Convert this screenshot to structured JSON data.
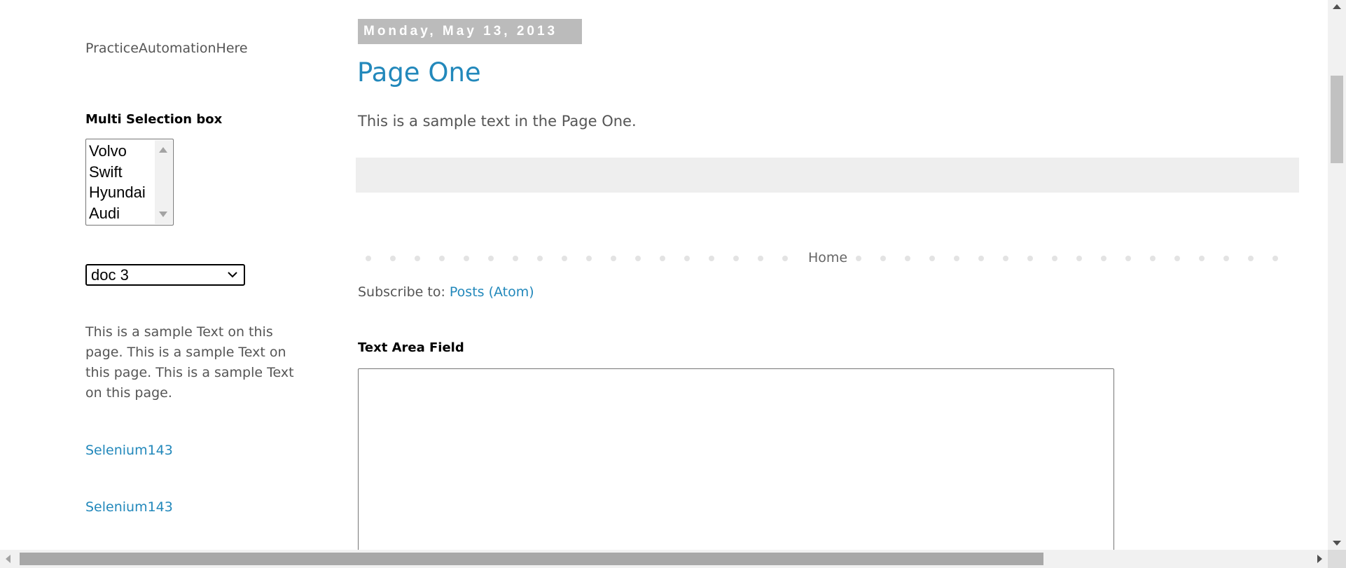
{
  "sidebar": {
    "blog_title": "PracticeAutomationHere",
    "multi_select": {
      "heading": "Multi Selection box",
      "options": [
        "Volvo",
        "Swift",
        "Hyundai",
        "Audi"
      ]
    },
    "dropdown": {
      "selected": "doc 3"
    },
    "text_widget": "This is a sample Text on this page. This is a sample Text on this page. This is a sample Text on this page.",
    "links": [
      "Selenium143",
      "Selenium143"
    ]
  },
  "main": {
    "date_header": "Monday, May 13, 2013",
    "post_title": "Page One",
    "post_body": "This is a sample text in the Page One.",
    "pager": {
      "home_label": "Home"
    },
    "subscribe": {
      "label": "Subscribe to: ",
      "link": "Posts (Atom)"
    },
    "text_area": {
      "heading": "Text Area Field",
      "value": ""
    }
  },
  "colors": {
    "link": "#2288bb",
    "date_header_bg": "#bbbbbb",
    "body_text": "#555555",
    "footer_bg": "#eeeeee"
  },
  "icons": {
    "dropdown": "chevron-down-icon",
    "listbox_scroll_up": "arrow-up-icon",
    "listbox_scroll_down": "arrow-down-icon"
  }
}
